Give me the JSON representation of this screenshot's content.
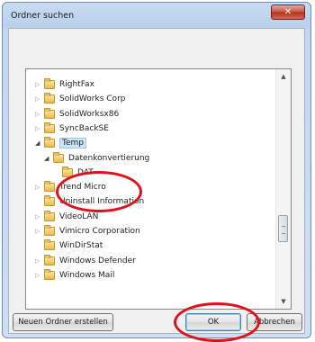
{
  "window": {
    "title": "Ordner suchen",
    "close_glyph": "✕",
    "description": ""
  },
  "tree": {
    "items": [
      {
        "label": "RightFax",
        "expander": "▷",
        "selected": false
      },
      {
        "label": "SolidWorks Corp",
        "expander": "▷",
        "selected": false
      },
      {
        "label": "SolidWorksx86",
        "expander": "▷",
        "selected": false
      },
      {
        "label": "SyncBackSE",
        "expander": "▷",
        "selected": false
      },
      {
        "label": "Temp",
        "expander": "◢",
        "selected": true
      },
      {
        "label": "Datenkonvertierung",
        "expander": "◢",
        "selected": false
      },
      {
        "label": "DAT",
        "expander": "",
        "selected": false
      },
      {
        "label": "Trend Micro",
        "expander": "▷",
        "selected": false
      },
      {
        "label": "Uninstall Information",
        "expander": "",
        "selected": false
      },
      {
        "label": "VideoLAN",
        "expander": "▷",
        "selected": false
      },
      {
        "label": "Vimicro Corporation",
        "expander": "▷",
        "selected": false
      },
      {
        "label": "WinDirStat",
        "expander": "",
        "selected": false
      },
      {
        "label": "Windows Defender",
        "expander": "▷",
        "selected": false
      },
      {
        "label": "Windows Mail",
        "expander": "▷",
        "selected": false
      }
    ],
    "scroll_up_glyph": "▲",
    "scroll_down_glyph": "▼"
  },
  "buttons": {
    "new_folder": "Neuen Ordner erstellen",
    "ok": "OK",
    "cancel": "Abbrechen"
  },
  "colors": {
    "annotation": "#e0101e",
    "selection": "#cce4f7"
  }
}
